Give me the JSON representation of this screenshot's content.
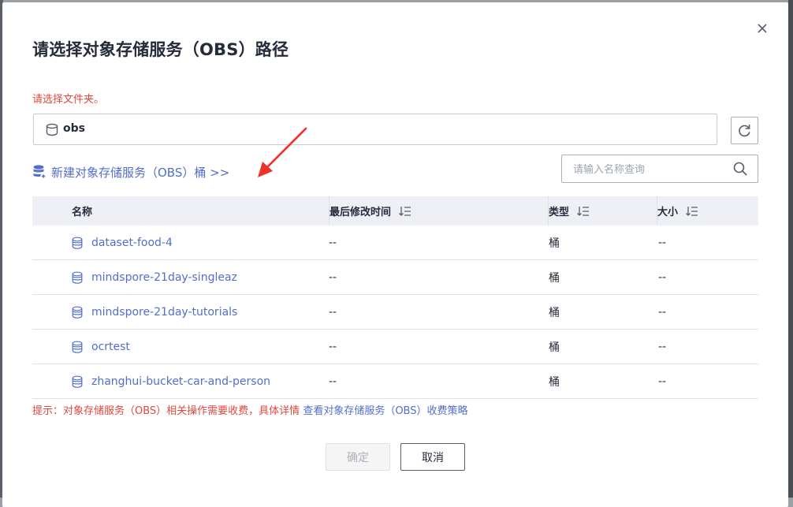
{
  "dialog": {
    "title": "请选择对象存储服务（OBS）路径",
    "hint": "请选择文件夹。",
    "path_value": "obs",
    "create_link": "新建对象存储服务（OBS）桶 >>",
    "search_placeholder": "请输入名称查询"
  },
  "table": {
    "headers": {
      "name": "名称",
      "modified": "最后修改时间",
      "type": "类型",
      "size": "大小"
    },
    "rows": [
      {
        "name": "dataset-food-4",
        "modified": "--",
        "type": "桶",
        "size": "--"
      },
      {
        "name": "mindspore-21day-singleaz",
        "modified": "--",
        "type": "桶",
        "size": "--"
      },
      {
        "name": "mindspore-21day-tutorials",
        "modified": "--",
        "type": "桶",
        "size": "--"
      },
      {
        "name": "ocrtest",
        "modified": "--",
        "type": "桶",
        "size": "--"
      },
      {
        "name": "zhanghui-bucket-car-and-person",
        "modified": "--",
        "type": "桶",
        "size": "--"
      }
    ]
  },
  "tip": {
    "text": "提示：对象存储服务（OBS）相关操作需要收费，具体详情 ",
    "link": "查看对象存储服务（OBS）收费策略"
  },
  "buttons": {
    "confirm": "确定",
    "cancel": "取消"
  },
  "colors": {
    "link": "#526ecc",
    "warning": "#e0483e",
    "arrow": "#f0302a"
  },
  "icons": [
    "close-icon",
    "bucket-icon",
    "refresh-icon",
    "create-bucket-icon",
    "search-icon",
    "sort-icon"
  ]
}
